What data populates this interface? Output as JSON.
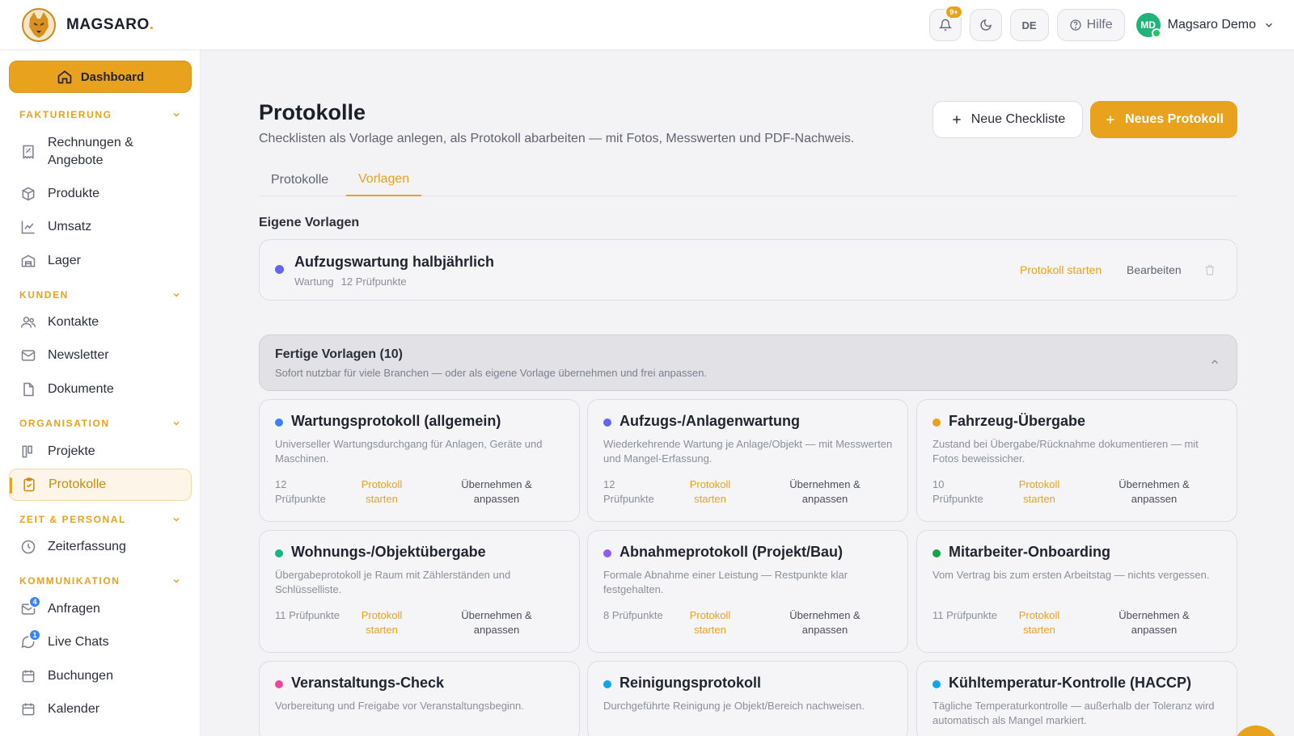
{
  "brand": {
    "name": "MAGSARO",
    "dot": ".",
    "accent": "#e8a21e"
  },
  "topbar": {
    "notifications_badge": "9+",
    "language": "DE",
    "help_label": "Hilfe",
    "user_initials": "MD",
    "user_name": "Magsaro Demo"
  },
  "sidebar": {
    "dashboard": "Dashboard",
    "sections": {
      "fakturierung": "FAKTURIERUNG",
      "kunden": "KUNDEN",
      "organisation": "ORGANISATION",
      "zeit": "ZEIT & PERSONAL",
      "kommunikation": "KOMMUNIKATION"
    },
    "items": {
      "rechnungen": "Rechnungen & Angebote",
      "produkte": "Produkte",
      "umsatz": "Umsatz",
      "lager": "Lager",
      "kontakte": "Kontakte",
      "newsletter": "Newsletter",
      "dokumente": "Dokumente",
      "projekte": "Projekte",
      "protokolle": "Protokolle",
      "zeiterfassung": "Zeiterfassung",
      "anfragen": "Anfragen",
      "live_chats": "Live Chats",
      "buchungen": "Buchungen",
      "kalender": "Kalender"
    },
    "badges": {
      "anfragen": "4",
      "live_chats": "1"
    }
  },
  "main": {
    "title": "Protokolle",
    "subtitle": "Checklisten als Vorlage anlegen, als Protokoll abarbeiten — mit Fotos, Messwerten und PDF-Nachweis.",
    "btn_new_checklist": "Neue Checkliste",
    "btn_new_protocol": "Neues Protokoll",
    "tabs": [
      "Protokolle",
      "Vorlagen"
    ],
    "own_section": "Eigene Vorlagen",
    "own_template": {
      "name": "Aufzugswartung halbjährlich",
      "category": "Wartung",
      "count": "12 Prüfpunkte",
      "color": "#6366f1",
      "start": "Protokoll starten",
      "edit": "Bearbeiten"
    },
    "ready": {
      "title": "Fertige Vorlagen (10)",
      "subtitle": "Sofort nutzbar für viele Branchen — oder als eigene Vorlage übernehmen und frei anpassen."
    },
    "cards": [
      {
        "name": "Wartungsprotokoll (allgemein)",
        "desc": "Universeller Wartungsdurchgang für Anlagen, Geräte und Maschinen.",
        "count": "12 Prüfpunkte",
        "start": "Protokoll starten",
        "take": "Übernehmen & anpassen",
        "color": "#3b82f6"
      },
      {
        "name": "Aufzugs-/Anlagenwartung",
        "desc": "Wiederkehrende Wartung je Anlage/Objekt — mit Messwerten und Mangel-Erfassung.",
        "count": "12 Prüfpunkte",
        "start": "Protokoll starten",
        "take": "Übernehmen & anpassen",
        "color": "#6366f1"
      },
      {
        "name": "Fahrzeug-Übergabe",
        "desc": "Zustand bei Übergabe/Rücknahme dokumentieren — mit Fotos beweissicher.",
        "count": "10 Prüfpunkte",
        "start": "Protokoll starten",
        "take": "Übernehmen & anpassen",
        "color": "#e8a21e"
      },
      {
        "name": "Wohnungs-/Objektübergabe",
        "desc": "Übergabeprotokoll je Raum mit Zählerständen und Schlüsselliste.",
        "count": "11 Prüfpunkte",
        "start": "Protokoll starten",
        "take": "Übernehmen & anpassen",
        "color": "#10b981"
      },
      {
        "name": "Abnahmeprotokoll (Projekt/Bau)",
        "desc": "Formale Abnahme einer Leistung — Restpunkte klar festgehalten.",
        "count": "8 Prüfpunkte",
        "start": "Protokoll starten",
        "take": "Übernehmen & anpassen",
        "color": "#8b5cf6"
      },
      {
        "name": "Mitarbeiter-Onboarding",
        "desc": "Vom Vertrag bis zum ersten Arbeitstag — nichts vergessen.",
        "count": "11 Prüfpunkte",
        "start": "Protokoll starten",
        "take": "Übernehmen & anpassen",
        "color": "#16a34a"
      },
      {
        "name": "Veranstaltungs-Check",
        "desc": "Vorbereitung und Freigabe vor Veranstaltungsbeginn.",
        "count": "",
        "start": "",
        "take": "",
        "color": "#ec4899"
      },
      {
        "name": "Reinigungsprotokoll",
        "desc": "Durchgeführte Reinigung je Objekt/Bereich nachweisen.",
        "count": "",
        "start": "",
        "take": "",
        "color": "#0ea5e9"
      },
      {
        "name": "Kühltemperatur-Kontrolle (HACCP)",
        "desc": "Tägliche Temperaturkontrolle — außerhalb der Toleranz wird automatisch als Mangel markiert.",
        "count": "",
        "start": "",
        "take": "",
        "color": "#0ea5e9"
      }
    ]
  }
}
